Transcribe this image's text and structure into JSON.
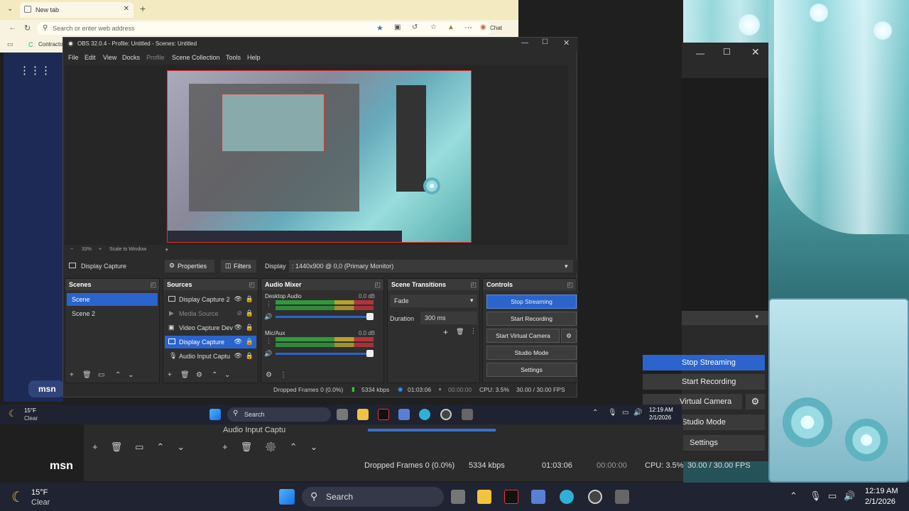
{
  "browser": {
    "tab_title": "New tab",
    "address_placeholder": "Search or enter web address",
    "chat_label": "Chat",
    "favorite_partial": "Contracto"
  },
  "obs": {
    "title": "OBS 32.0.4 - Profile: Untitled - Scenes: Untitled",
    "menu": [
      "File",
      "Edit",
      "View",
      "Docks",
      "Profile",
      "Scene Collection",
      "Tools",
      "Help"
    ],
    "preview": {
      "zoom": "33%",
      "scale_mode": "Scale to Window"
    },
    "source_bar": {
      "selected_source": "Display Capture",
      "properties": "Properties",
      "filters": "Filters",
      "display_label": "Display",
      "display_value": ": 1440x900 @ 0,0 (Primary Monitor)"
    },
    "scenes": {
      "header": "Scenes",
      "items": [
        "Scene",
        "Scene 2"
      ],
      "selected": 0
    },
    "sources": {
      "header": "Sources",
      "items": [
        "Display Capture 2",
        "Media Source",
        "Video Capture Dev",
        "Display Capture",
        "Audio Input Captu"
      ],
      "selected": 3
    },
    "audio_mixer": {
      "header": "Audio Mixer",
      "channels": [
        {
          "name": "Desktop Audio",
          "db": "0.0 dB"
        },
        {
          "name": "Mic/Aux",
          "db": "0.0 dB"
        }
      ],
      "scale": [
        "-60",
        "-55",
        "-50",
        "-45",
        "-40",
        "-35",
        "-30",
        "-25",
        "-20",
        "-15",
        "-10",
        "-5",
        "0"
      ]
    },
    "transitions": {
      "header": "Scene Transitions",
      "type": "Fade",
      "duration_label": "Duration",
      "duration_value": "300 ms"
    },
    "controls": {
      "header": "Controls",
      "stop_streaming": "Stop Streaming",
      "start_recording": "Start Recording",
      "start_virtual_camera": "Start Virtual Camera",
      "studio_mode": "Studio Mode",
      "settings": "Settings"
    },
    "status": {
      "dropped_frames": "Dropped Frames 0 (0.0%)",
      "bitrate": "5334 kbps",
      "stream_time": "01:03:06",
      "record_time": "00:00:00",
      "cpu": "CPU: 3.5%",
      "fps": "30.00 / 30.00 FPS"
    }
  },
  "back_obs": {
    "stop_streaming": "Stop Streaming",
    "start_recording": "Start Recording",
    "virtual_camera": "Virtual Camera",
    "studio_mode": "Studio Mode",
    "settings": "Settings",
    "audio_source": "Audio Input Captu",
    "dropped_frames": "Dropped Frames 0 (0.0%)",
    "bitrate": "5334 kbps",
    "stream_time": "01:03:06",
    "record_time": "00:00:00",
    "cpu": "CPU: 3.5%",
    "fps": "30.00 / 30.00 FPS",
    "msn": "msn"
  },
  "taskbar": {
    "weather_temp": "15°F",
    "weather_cond": "Clear",
    "search": "Search",
    "time": "12:19 AM",
    "date": "2/1/2026"
  },
  "colors": {
    "accent": "#2a64cc",
    "record_red": "#e03030"
  }
}
